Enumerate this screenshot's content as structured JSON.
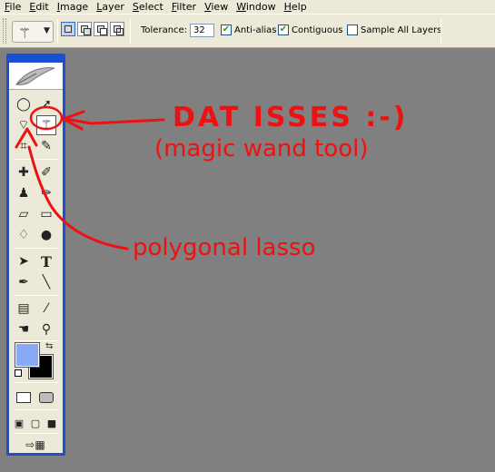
{
  "menu": [
    {
      "label": "File",
      "mn": "F",
      "rest": "ile"
    },
    {
      "label": "Edit",
      "mn": "E",
      "rest": "dit"
    },
    {
      "label": "Image",
      "mn": "I",
      "rest": "mage"
    },
    {
      "label": "Layer",
      "mn": "L",
      "rest": "ayer"
    },
    {
      "label": "Select",
      "mn": "S",
      "rest": "elect"
    },
    {
      "label": "Filter",
      "mn": "F",
      "rest": "ilter"
    },
    {
      "label": "View",
      "mn": "V",
      "rest": "iew"
    },
    {
      "label": "Window",
      "mn": "W",
      "rest": "indow"
    },
    {
      "label": "Help",
      "mn": "H",
      "rest": "elp"
    }
  ],
  "options": {
    "tolerance_label": "Tolerance:",
    "tolerance_value": "32",
    "anti_alias": {
      "label": "Anti-alias",
      "checked": true
    },
    "contiguous": {
      "label": "Contiguous",
      "checked": true
    },
    "sample_all_layers": {
      "label": "Sample All Layers",
      "checked": false
    }
  },
  "toolbox": {
    "foreground_color": "#88aaf4",
    "background_color": "#000000"
  },
  "annotations": {
    "magic_wand_title": "DAT ISSES :-)",
    "magic_wand_sub": "(magic  wand  tool)",
    "lasso": "polygonal  lasso",
    "color": "#ee1111"
  }
}
